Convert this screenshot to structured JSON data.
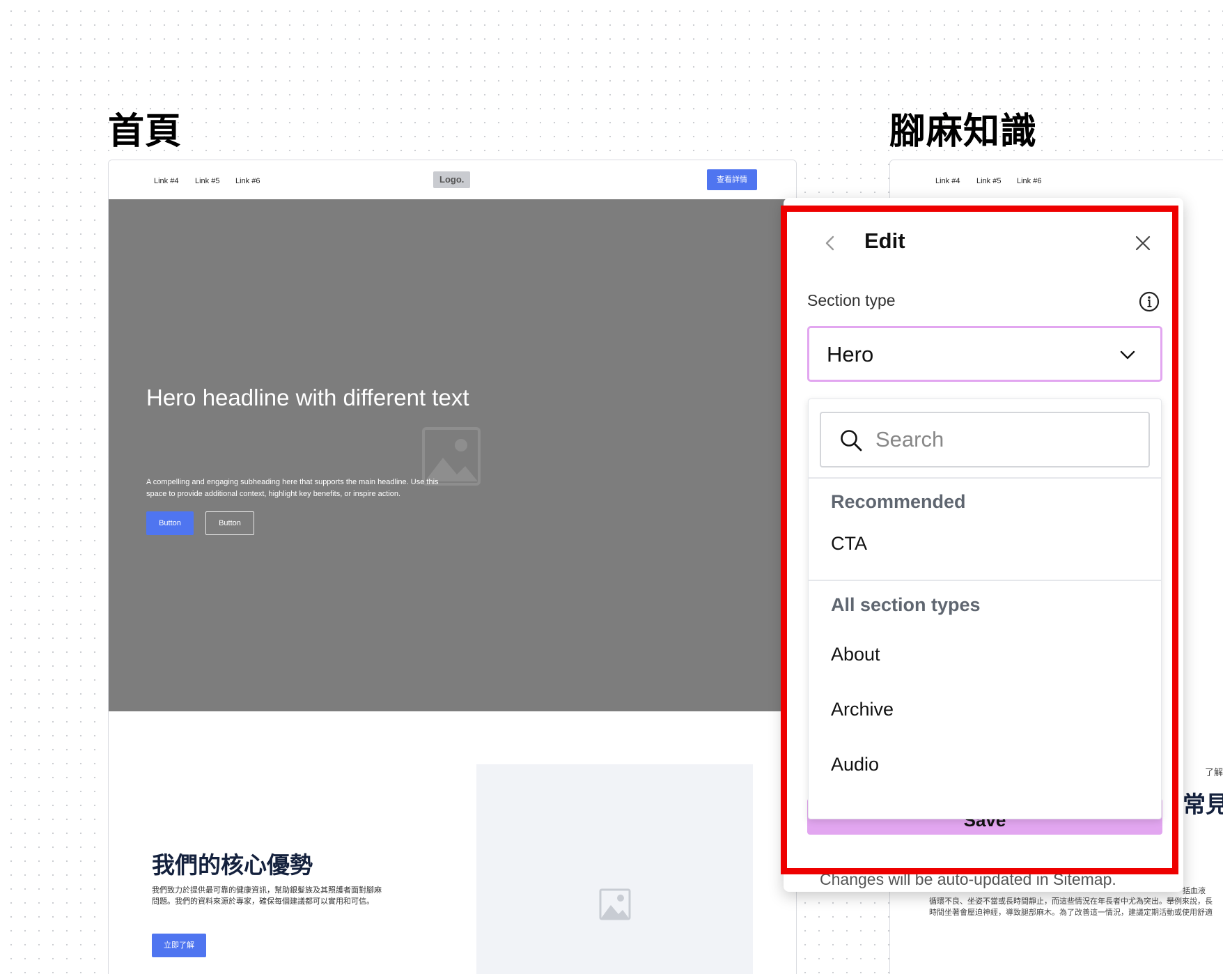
{
  "canvas": {
    "pages": [
      {
        "label": "首頁",
        "nav": {
          "links": [
            "Link #4",
            "Link #5",
            "Link #6"
          ],
          "logo": "Logo.",
          "cta": "查看詳情"
        },
        "hero": {
          "title": "Hero headline with different text",
          "subtitle": "A compelling and engaging subheading here that supports the main headline. Use this space to provide additional context, highlight key benefits, or inspire action.",
          "primary_button": "Button",
          "secondary_button": "Button"
        },
        "about": {
          "title": "我們的核心優勢",
          "text": "我們致力於提供最可靠的健康資訊，幫助銀髮族及其照護者面對腳麻問題。我們的資料來源於專家，確保每個建議都可以實用和可信。",
          "button": "立即了解"
        }
      },
      {
        "label": "腳麻知識",
        "nav": {
          "links": [
            "Link #4",
            "Link #5",
            "Link #6"
          ]
        },
        "peek": {
          "line_1": "了解",
          "line_2": "常見",
          "text_1": "括血液",
          "text_2": "循環不良、坐姿不當或長時間靜止，而這些情況在年長者中尤為突出。舉例來說，長",
          "text_3": "時間坐著會壓迫神經，導致腿部麻木。為了改善這一情況，建議定期活動或使用舒適"
        }
      }
    ]
  },
  "edit_panel": {
    "title": "Edit",
    "back_icon": "chevron-left-icon",
    "close_icon": "close-icon",
    "section_type_label": "Section type",
    "info_icon": "info-icon",
    "selected_value": "Hero",
    "search": {
      "placeholder": "Search",
      "value": ""
    },
    "groups": [
      {
        "header": "Recommended",
        "options": [
          "CTA"
        ]
      },
      {
        "header": "All section types",
        "options": [
          "About",
          "Archive",
          "Audio"
        ]
      }
    ],
    "save_label": "Save",
    "footnote": "Changes will be auto-updated in Sitemap."
  },
  "colors": {
    "accent_blue": "#4f75f0",
    "select_border": "#e2a6f0",
    "save_button": "#e2a6f0",
    "highlight_border": "#ee0000",
    "hero_background": "#7d7d7d"
  }
}
